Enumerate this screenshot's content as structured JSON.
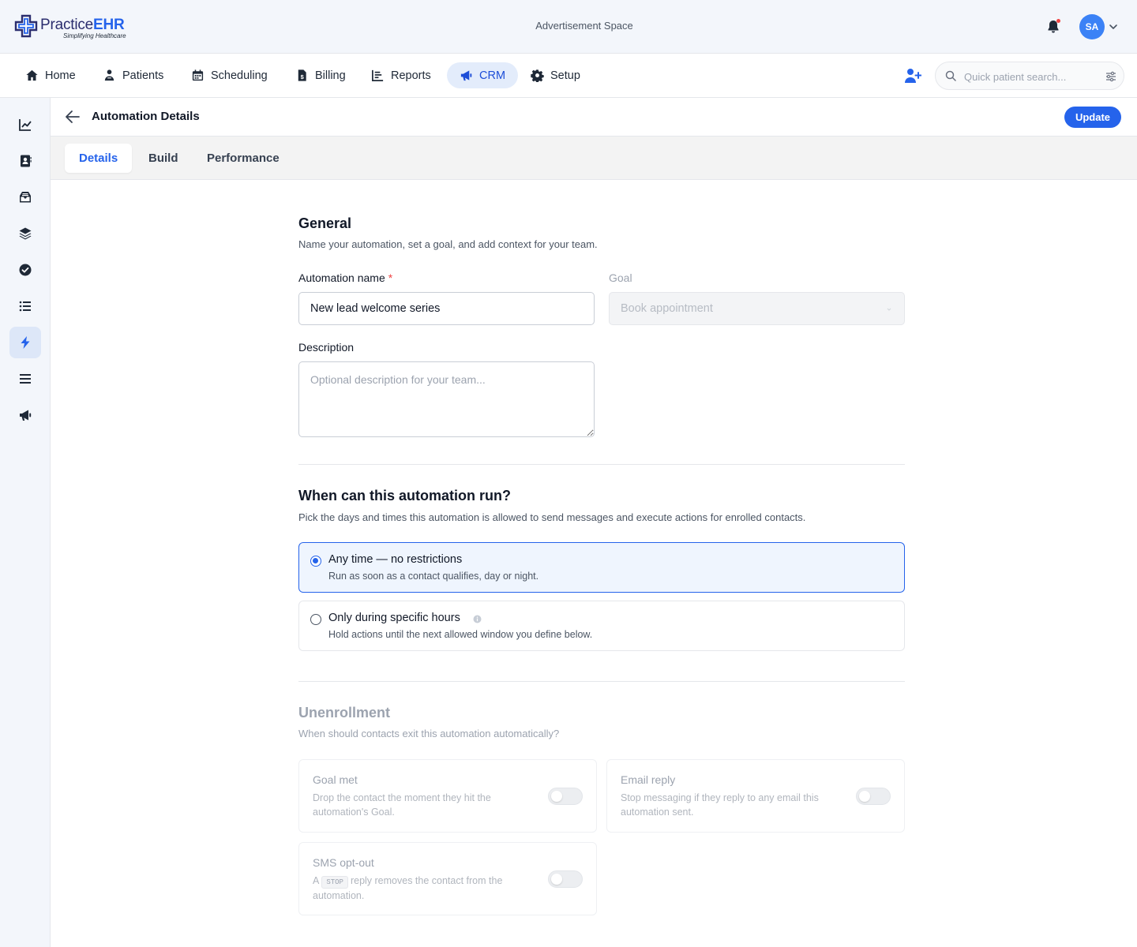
{
  "app": {
    "logo_text_a": "Practice",
    "logo_text_b": "EHR",
    "logo_tagline": "Simplifying Healthcare",
    "ad_space": "Advertisement Space",
    "user_initials": "SA"
  },
  "nav": {
    "items": [
      {
        "label": "Home",
        "icon": "home-icon"
      },
      {
        "label": "Patients",
        "icon": "patients-icon"
      },
      {
        "label": "Scheduling",
        "icon": "calendar-icon"
      },
      {
        "label": "Billing",
        "icon": "billing-icon"
      },
      {
        "label": "Reports",
        "icon": "reports-icon"
      },
      {
        "label": "CRM",
        "icon": "megaphone-icon",
        "active": true
      },
      {
        "label": "Setup",
        "icon": "gear-icon"
      }
    ],
    "search_placeholder": "Quick patient search..."
  },
  "sidebar": {
    "items": [
      "chart-line-icon",
      "contacts-book-icon",
      "inbox-icon",
      "layers-icon",
      "check-circle-icon",
      "list-icon",
      "lightning-icon",
      "menu-lines-icon",
      "megaphone-icon"
    ],
    "active_index": 6
  },
  "header": {
    "title": "Automation Details",
    "update_label": "Update"
  },
  "tabs": [
    {
      "label": "Details",
      "active": true
    },
    {
      "label": "Build"
    },
    {
      "label": "Performance"
    }
  ],
  "general": {
    "title": "General",
    "subtitle": "Name your automation, set a goal, and add context for your team.",
    "name_label": "Automation name",
    "required_mark": "*",
    "name_value": "New lead welcome series",
    "goal_label": "Goal",
    "goal_value": "Book appointment",
    "description_label": "Description",
    "description_placeholder": "Optional description for your team..."
  },
  "schedule": {
    "title": "When can this automation run?",
    "subtitle": "Pick the days and times this automation is allowed to send messages and execute actions for enrolled contacts.",
    "options": [
      {
        "title": "Any time — no restrictions",
        "desc": "Run as soon as a contact qualifies, day or night.",
        "selected": true
      },
      {
        "title": "Only during specific hours",
        "desc": "Hold actions until the next allowed window you define below.",
        "selected": false
      }
    ]
  },
  "unenroll": {
    "title": "Unenrollment",
    "subtitle": "When should contacts exit this automation automatically?",
    "goal_met": {
      "title": "Goal met",
      "desc": "Drop the contact the moment they hit the automation's Goal.",
      "enabled": false
    },
    "email_reply": {
      "title": "Email reply",
      "desc": "Stop messaging if they reply to any email this automation sent.",
      "enabled": false
    },
    "sms_optout": {
      "title": "SMS opt-out",
      "desc_a": "A",
      "keyword": "STOP",
      "desc_b": "reply removes the contact from the automation.",
      "enabled": false
    }
  },
  "colors": {
    "accent": "#2563eb",
    "active_nav_bg": "#e3ecfb",
    "selected_card_bg": "#eff5fe",
    "notification_dot": "#ef4444"
  }
}
